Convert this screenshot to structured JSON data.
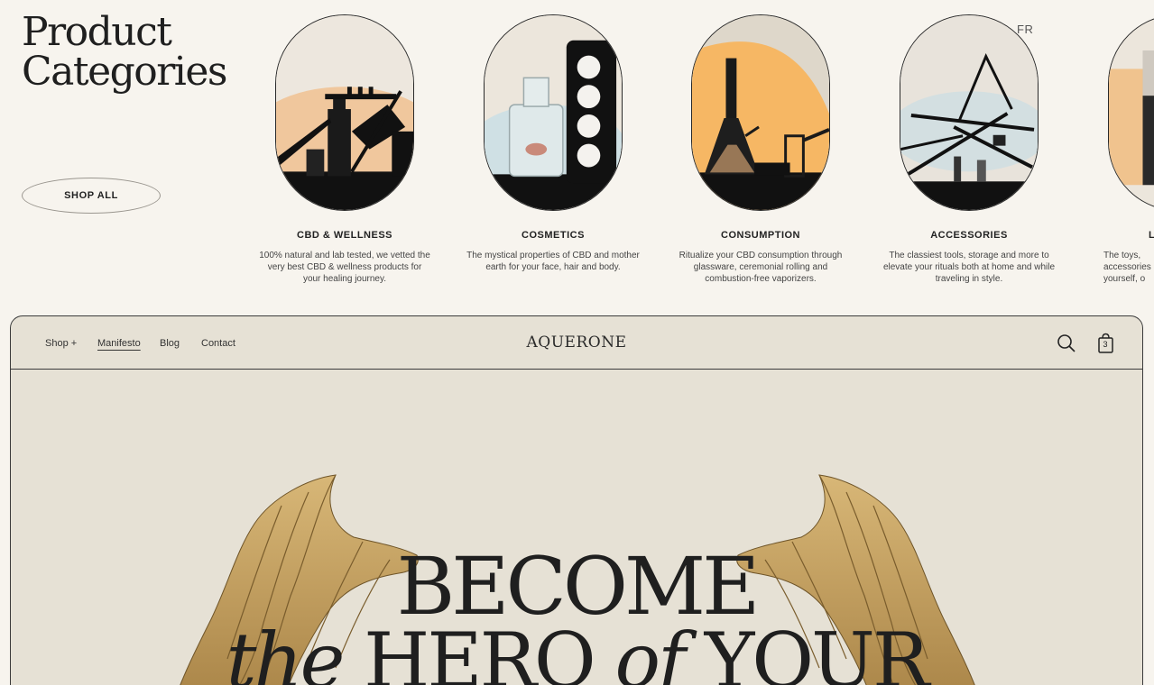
{
  "categories_section": {
    "title_line1": "Product",
    "title_line2": "Categories",
    "shop_all_label": "SHOP ALL",
    "lang_toggle": "FR",
    "items": [
      {
        "title": "CBD & WELLNESS",
        "description": "100% natural and lab tested, we vetted the very best CBD & wellness products for your healing journey."
      },
      {
        "title": "COSMETICS",
        "description": "The mystical properties of CBD and mother earth for your face, hair and body."
      },
      {
        "title": "CONSUMPTION",
        "description": "Ritualize your CBD consumption through glassware, ceremonial rolling and combustion-free vaporizers."
      },
      {
        "title": "ACCESSORIES",
        "description": "The classiest tools, storage and more to elevate your rituals both at home and while traveling in style."
      },
      {
        "title": "L",
        "description": "The toys, accessories yourself, o"
      }
    ]
  },
  "nav": {
    "links": [
      "Shop +",
      "Manifesto",
      "Blog",
      "Contact"
    ],
    "active": "Manifesto",
    "logo": "AQUERONE",
    "cart_count": "3",
    "icons": [
      "search-icon",
      "cart-icon"
    ]
  },
  "hero": {
    "headline_line1": "BECOME",
    "headline_line2_italic1": "the",
    "headline_line2_word1": "HERO",
    "headline_line2_italic2": "of",
    "headline_line2_word2": "YOUR"
  },
  "colors": {
    "page_bg": "#f7f4ee",
    "frame_bg": "#e6e1d5",
    "text": "#1f1f1f",
    "wing_gold": "#c9a464"
  }
}
